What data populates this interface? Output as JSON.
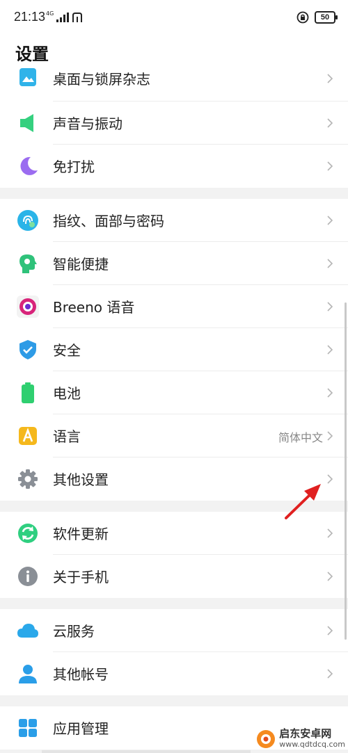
{
  "status_bar": {
    "time": "21:13",
    "network": "4G",
    "battery": "50"
  },
  "header": {
    "title": "设置"
  },
  "groups": [
    {
      "items": [
        {
          "label": "桌面与锁屏杂志",
          "icon": "wallpaper-icon",
          "color": "#30b3e9"
        },
        {
          "label": "声音与振动",
          "icon": "speaker-icon",
          "color": "#35d07f"
        },
        {
          "label": "免打扰",
          "icon": "moon-icon",
          "color": "#9b6cf0"
        }
      ]
    },
    {
      "items": [
        {
          "label": "指纹、面部与密码",
          "icon": "fingerprint-icon",
          "color": "#2ab4e8"
        },
        {
          "label": "智能便捷",
          "icon": "smart-head-icon",
          "color": "#2fc27a"
        },
        {
          "label": "Breeno 语音",
          "icon": "breeno-icon",
          "color": "#d8247a"
        },
        {
          "label": "安全",
          "icon": "shield-icon",
          "color": "#2e9be6"
        },
        {
          "label": "电池",
          "icon": "battery-icon",
          "color": "#2fcf70"
        },
        {
          "label": "语言",
          "value": "简体中文",
          "icon": "language-icon",
          "color": "#f5b81c"
        },
        {
          "label": "其他设置",
          "icon": "gear-icon",
          "color": "#8a8f96"
        }
      ]
    },
    {
      "items": [
        {
          "label": "软件更新",
          "icon": "update-icon",
          "color": "#2fcf80"
        },
        {
          "label": "关于手机",
          "icon": "info-icon",
          "color": "#8a8f96"
        }
      ]
    },
    {
      "items": [
        {
          "label": "云服务",
          "icon": "cloud-icon",
          "color": "#2aa8ea"
        },
        {
          "label": "其他帐号",
          "icon": "person-icon",
          "color": "#2a9ee8"
        }
      ]
    },
    {
      "items": [
        {
          "label": "应用管理",
          "icon": "apps-grid-icon",
          "color": "#2a9ee8"
        }
      ]
    }
  ],
  "watermark": {
    "name": "启东安卓网",
    "url": "www.qdtdcq.com"
  }
}
